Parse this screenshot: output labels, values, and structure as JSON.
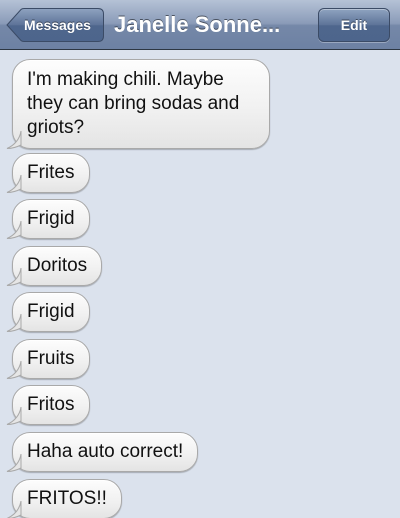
{
  "navbar": {
    "back_label": "Messages",
    "title": "Janelle Sonne...",
    "edit_label": "Edit"
  },
  "conversation": {
    "messages": [
      "I'm making chili. Maybe they can bring sodas and griots?",
      "Frites",
      "Frigid",
      "Doritos",
      "Frigid",
      "Fruits",
      "Fritos",
      "Haha auto correct!",
      "FRITOS!!"
    ]
  },
  "colors": {
    "background": "#dbe2ed",
    "navbar": "#6d81a3",
    "bubble": "#f1f1f1"
  }
}
